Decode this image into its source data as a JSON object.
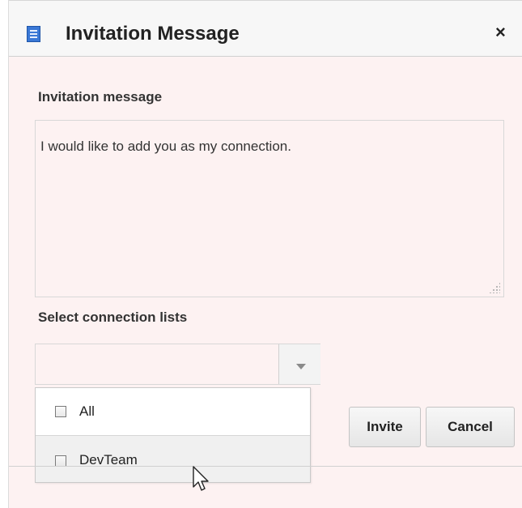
{
  "dialog": {
    "title": "Invitation Message",
    "title_icon": "document-icon",
    "close_symbol": "×"
  },
  "message": {
    "label": "Invitation message",
    "value": "I would like to add you as my connection."
  },
  "connections": {
    "label": "Select connection lists",
    "selected_value": "",
    "options": [
      {
        "label": "All",
        "checked": false
      },
      {
        "label": "DevTeam",
        "checked": false
      }
    ]
  },
  "buttons": {
    "invite": "Invite",
    "cancel": "Cancel"
  },
  "colors": {
    "dialog_background": "#fdf2f2",
    "titlebar_background": "#f7f7f7"
  }
}
